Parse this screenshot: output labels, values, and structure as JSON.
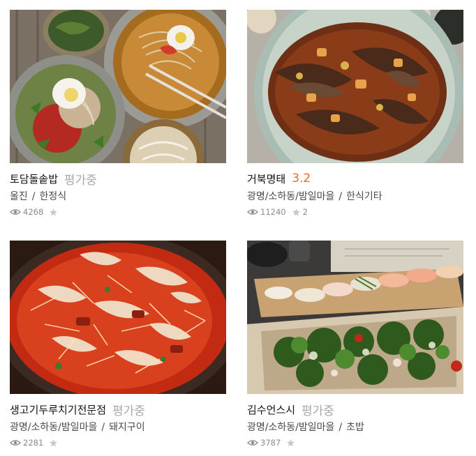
{
  "colors": {
    "rating_scored": "#f26a22",
    "rating_pending": "#a8a8a8",
    "stat_gray": "#8a8a8a"
  },
  "restaurants": [
    {
      "name": "토담돌솥밥",
      "rating": "평가중",
      "location": "울진",
      "category": "한정식",
      "views": "4268",
      "likes": "",
      "image_alt": "냉면과 비빔냉면"
    },
    {
      "name": "거북명태",
      "rating": "3.2",
      "location": "광명/소하동/밤일마을",
      "category": "한식기타",
      "views": "11240",
      "likes": "2",
      "image_alt": "명태조림"
    },
    {
      "name": "생고기두루치기전문점",
      "rating": "평가중",
      "location": "광명/소하동/밤일마을",
      "category": "돼지구이",
      "views": "2281",
      "likes": "",
      "image_alt": "두루치기"
    },
    {
      "name": "김수언스시",
      "rating": "평가중",
      "location": "광명/소하동/밤일마을",
      "category": "초밥",
      "views": "3787",
      "likes": "",
      "image_alt": "초밥과 샐러드"
    }
  ],
  "icons": {
    "views": "eye-icon",
    "likes": "star-icon"
  }
}
